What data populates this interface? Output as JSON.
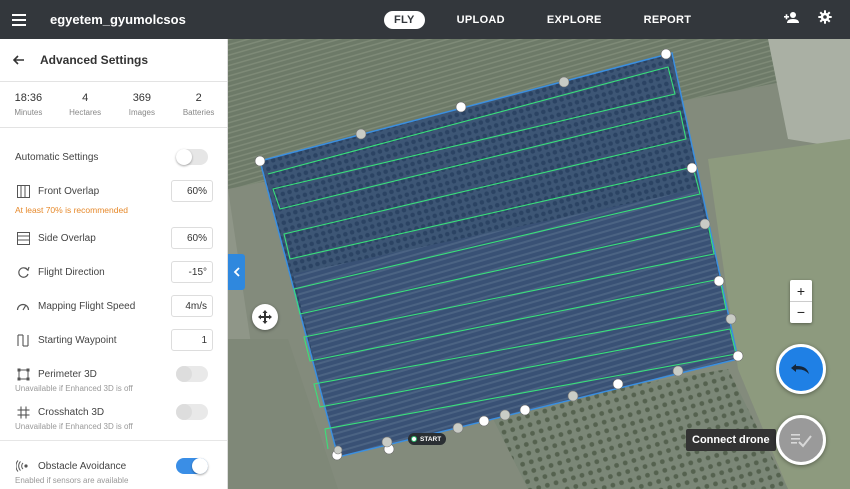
{
  "app": {
    "project_title": "egyetem_gyumolcsos"
  },
  "nav": {
    "tabs": [
      "FLY",
      "UPLOAD",
      "EXPLORE",
      "REPORT"
    ],
    "active": "FLY"
  },
  "panel": {
    "title": "Advanced Settings",
    "stats": [
      {
        "value": "18:36",
        "label": "Minutes"
      },
      {
        "value": "4",
        "label": "Hectares"
      },
      {
        "value": "369",
        "label": "Images"
      },
      {
        "value": "2",
        "label": "Batteries"
      }
    ],
    "automatic_settings": {
      "label": "Automatic Settings",
      "enabled": false
    },
    "front_overlap": {
      "label": "Front Overlap",
      "value": "60%",
      "warning": "At least 70% is recommended"
    },
    "side_overlap": {
      "label": "Side Overlap",
      "value": "60%"
    },
    "flight_direction": {
      "label": "Flight Direction",
      "value": "-15°"
    },
    "mapping_speed": {
      "label": "Mapping Flight Speed",
      "value": "4m/s"
    },
    "starting_waypoint": {
      "label": "Starting Waypoint",
      "value": "1"
    },
    "perimeter_3d": {
      "label": "Perimeter 3D",
      "hint": "Unavailable if Enhanced 3D is off",
      "enabled": false
    },
    "crosshatch_3d": {
      "label": "Crosshatch 3D",
      "hint": "Unavailable if Enhanced 3D is off",
      "enabled": false
    },
    "obstacle_avoidance": {
      "label": "Obstacle Avoidance",
      "hint": "Enabled if sensors are available",
      "enabled": true
    }
  },
  "map": {
    "start_label": "START",
    "zoom_in": "+",
    "zoom_out": "−",
    "connect_drone_label": "Connect drone",
    "colors": {
      "boundary": "#3b8fe0",
      "flight_path": "#39e07a",
      "accent": "#1f80e5",
      "warning": "#e6892b"
    }
  },
  "icons": {
    "menu": "hamburger-icon",
    "add_user": "add-user-icon",
    "settings": "gear-icon",
    "back": "arrow-left-icon",
    "collapse": "chevron-left-icon",
    "move": "move-icon",
    "undo": "undo-icon",
    "checklist": "checklist-icon"
  }
}
